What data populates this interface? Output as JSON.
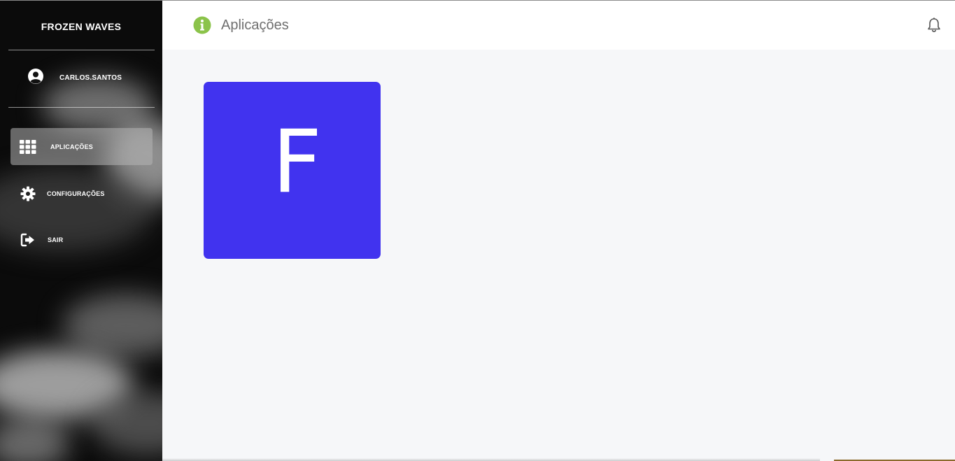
{
  "sidebar": {
    "brand": "FROZEN WAVES",
    "user": {
      "name": "CARLOS.SANTOS",
      "icon": "user-circle-icon"
    },
    "items": [
      {
        "label": "APLICAÇÕES",
        "icon": "grid-icon",
        "active": true
      },
      {
        "label": "CONFIGURAÇÕES",
        "icon": "gear-icon",
        "active": false
      },
      {
        "label": "SAIR",
        "icon": "sign-out-icon",
        "active": false
      }
    ]
  },
  "header": {
    "title": "Aplicações",
    "info_icon": "info-icon",
    "info_icon_color": "#8bc34a",
    "bell_icon": "bell-icon"
  },
  "main": {
    "apps": [
      {
        "letter": "F",
        "color": "#4133ef"
      }
    ]
  }
}
